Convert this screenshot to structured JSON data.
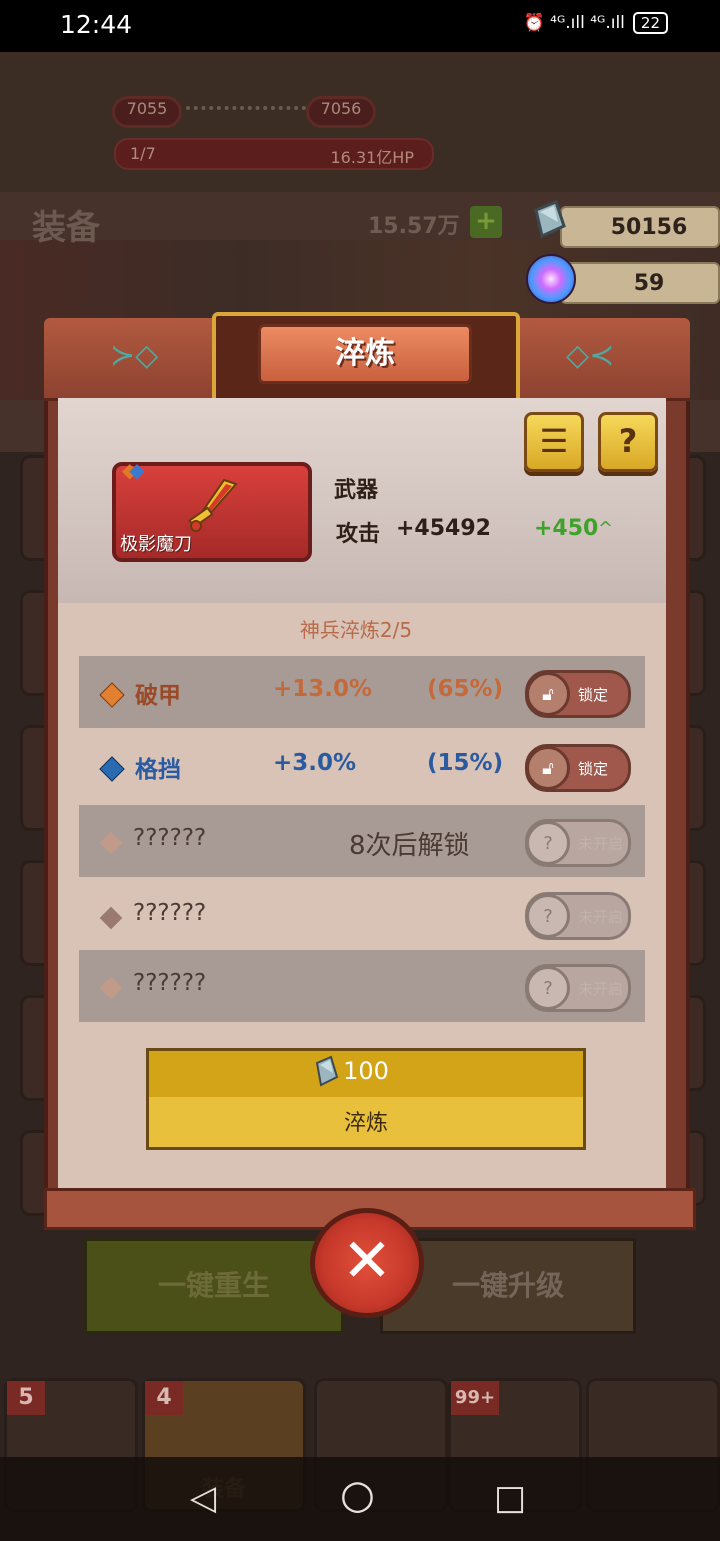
{
  "status_bar": {
    "time": "12:44",
    "signal": "⏰ ⁴ᴳ.ıll ⁴ᴳ.ıll",
    "battery": "22"
  },
  "background": {
    "progress_left": "7055",
    "progress_right": "7056",
    "stage": "1/7",
    "boss_hp": "16.31亿HP",
    "section_title": "装备",
    "power": "15.57万",
    "rebirth_label": "一键重生",
    "upgrade_label": "一键升级",
    "tabs": [
      {
        "badge": "5",
        "label": ""
      },
      {
        "badge": "4",
        "label": "装备"
      },
      {
        "badge": "",
        "label": ""
      },
      {
        "badge": "99+",
        "label": ""
      },
      {
        "badge": "",
        "label": ""
      }
    ]
  },
  "currency": {
    "gems": "50156",
    "orbs": "59"
  },
  "dialog": {
    "title": "淬炼",
    "menu_icon": "☰",
    "help_icon": "?",
    "item": {
      "name": "极影魔刀",
      "type": "武器",
      "attack_label": "攻击",
      "attack_value": "+45492",
      "attack_increase": "+450",
      "arrow": "^"
    },
    "refine_level": "神兵淬炼2/5",
    "attributes": [
      {
        "name": "破甲",
        "value": "+13.0%",
        "chance": "(65%)",
        "toggle": "锁定",
        "color": "#e08030",
        "text_color": "#9a4a26",
        "value_color": "#c46a3a"
      },
      {
        "name": "格挡",
        "value": "+3.0%",
        "chance": "(15%)",
        "toggle": "锁定",
        "color": "#2a6ab0",
        "text_color": "#2a5aa0",
        "value_color": "#2a5aa0"
      },
      {
        "name": "??????",
        "unlock": "8次后解锁",
        "toggle": "未开启",
        "color": "#c29a8a"
      },
      {
        "name": "??????",
        "toggle": "未开启",
        "color": "#9a7a70"
      },
      {
        "name": "??????",
        "toggle": "未开启",
        "color": "#c29a8a"
      }
    ],
    "refine_button": {
      "cost": "100",
      "label": "淬炼"
    },
    "close_icon": "✕"
  },
  "nav": {
    "back": "◁",
    "home": "○",
    "recents": "□"
  }
}
